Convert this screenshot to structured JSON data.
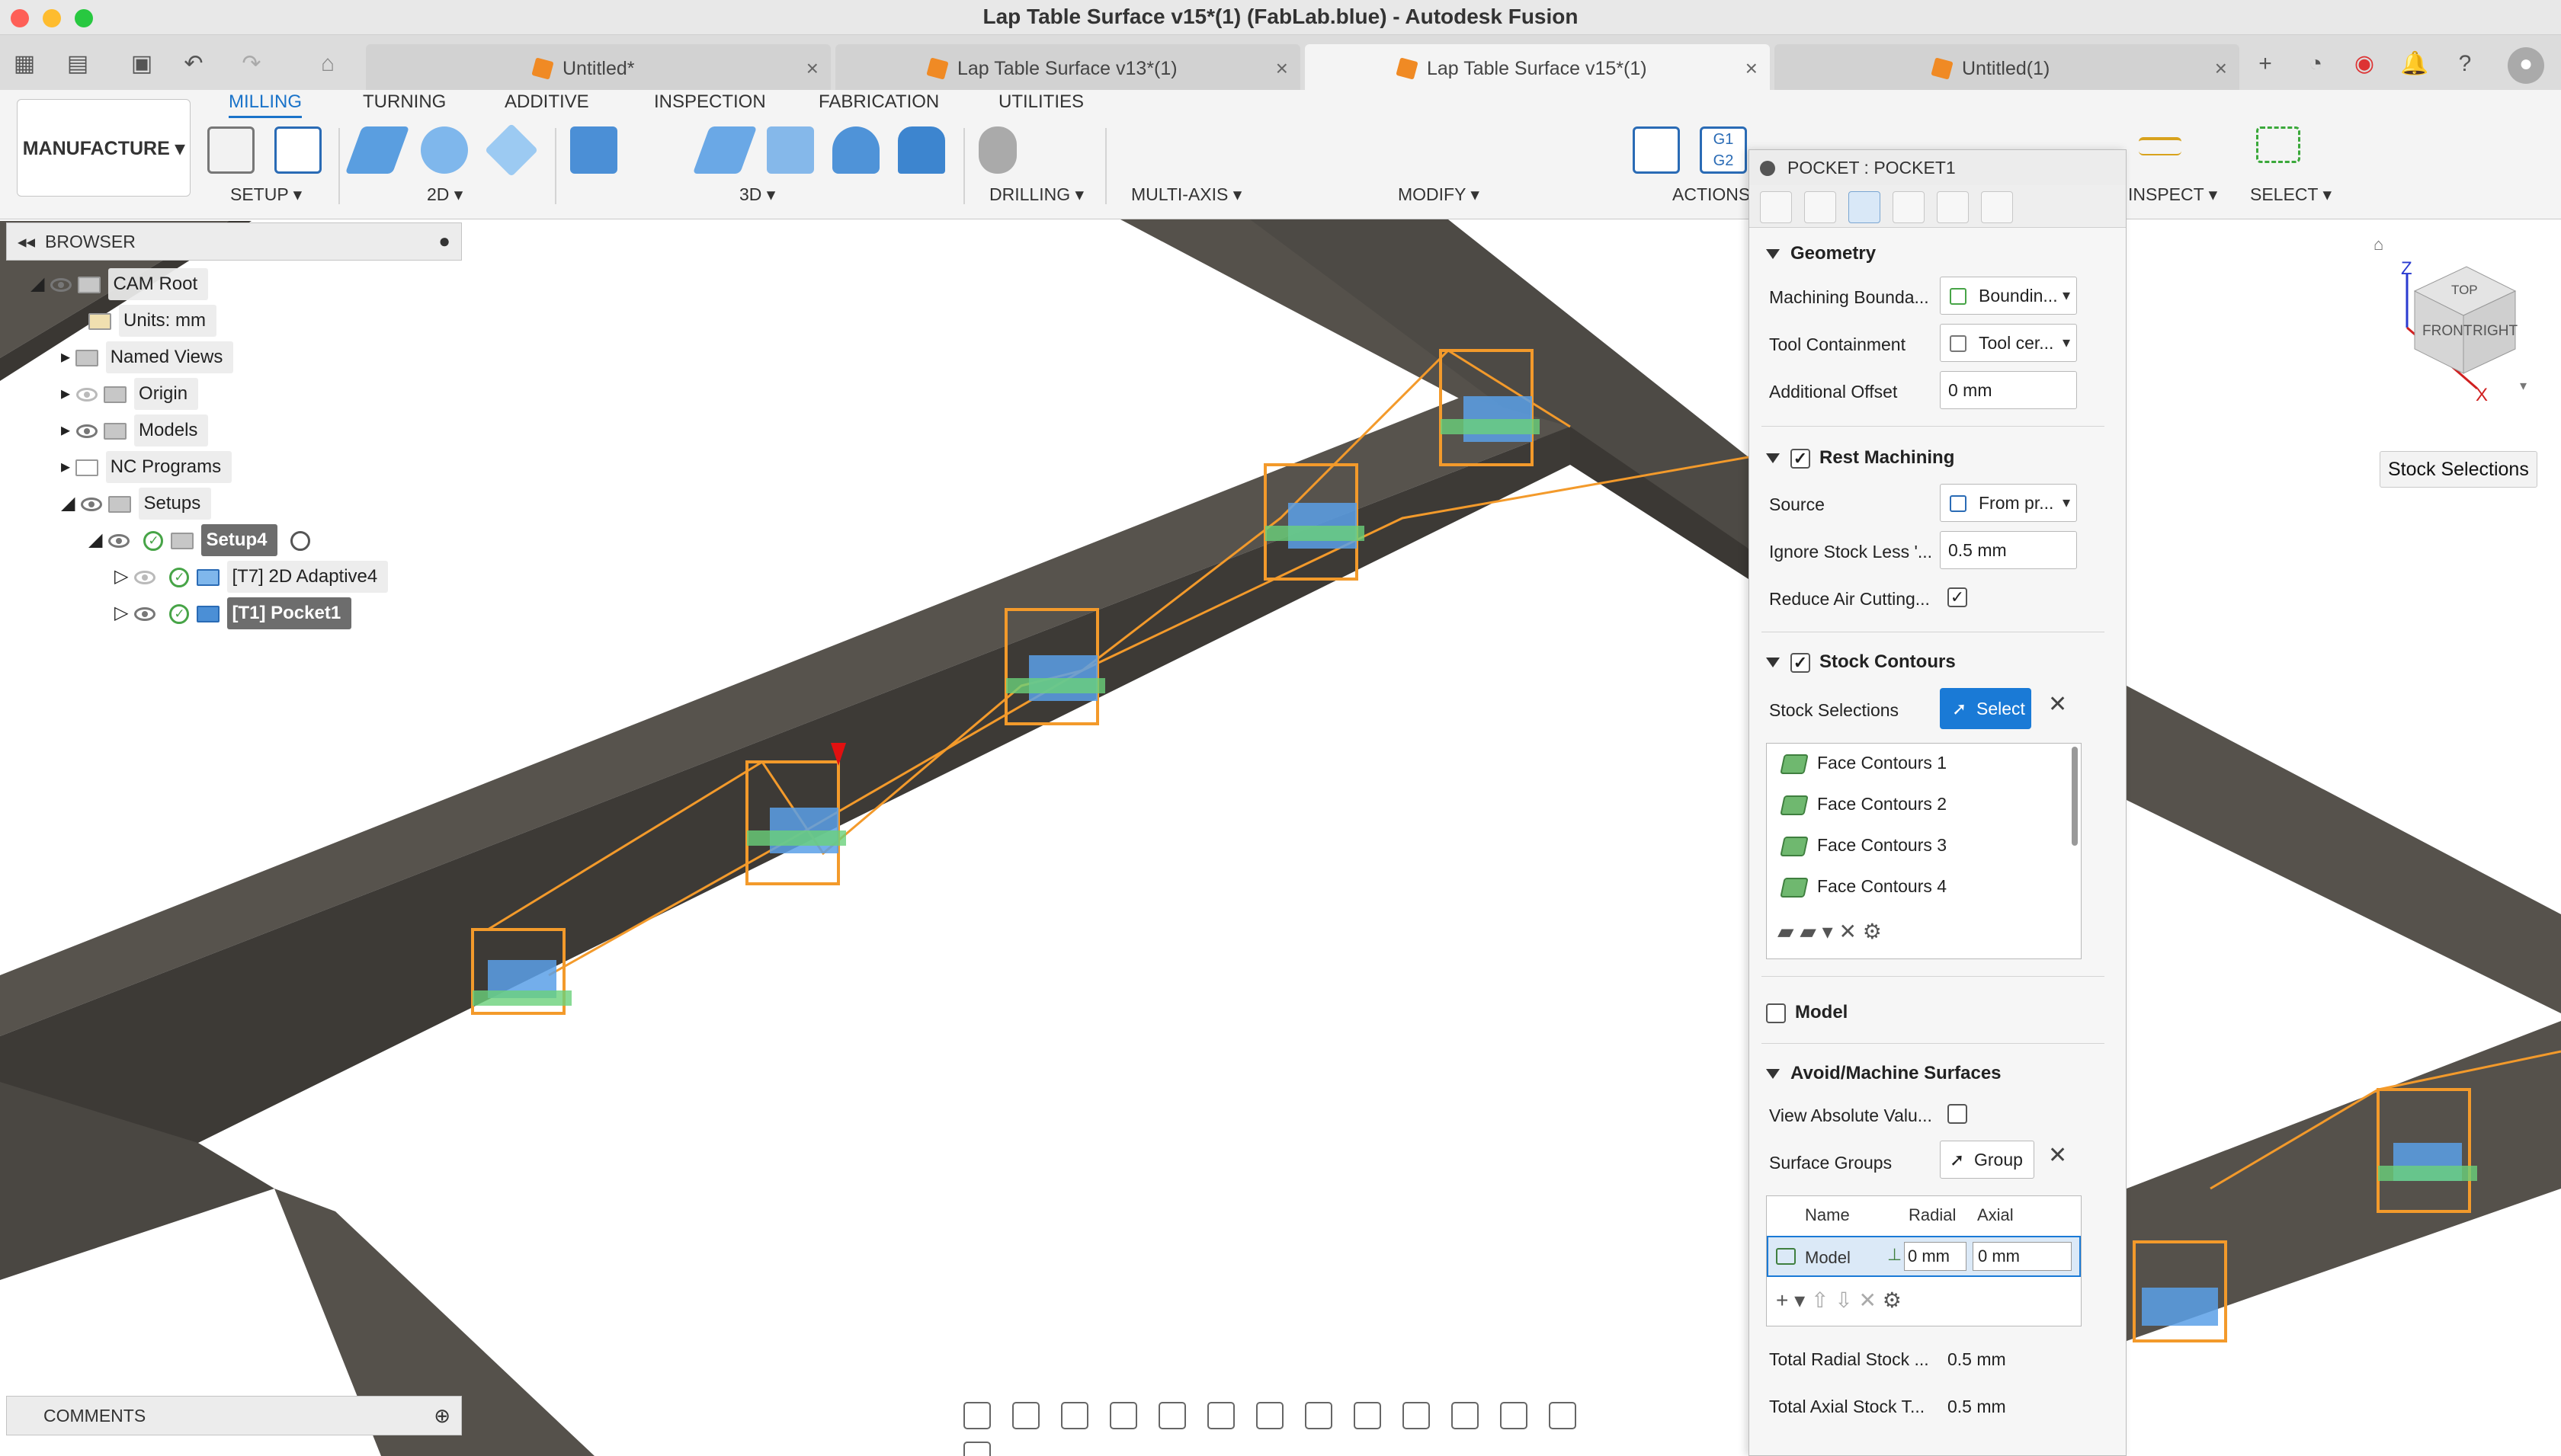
{
  "window": {
    "title": "Lap Table Surface v15*(1) (FabLab.blue) - Autodesk Fusion"
  },
  "doc_tabs": [
    {
      "label": "Untitled*"
    },
    {
      "label": "Lap Table Surface v13*(1)"
    },
    {
      "label": "Lap Table Surface v15*(1)"
    },
    {
      "label": "Untitled(1)"
    }
  ],
  "colors": {
    "accent": "#1a7ad6",
    "toolpath": "#f39a2b",
    "stock": "#4d4a45",
    "link": "#f39a2b"
  },
  "ribbon": {
    "workspace": "MANUFACTURE",
    "tabs": [
      "MILLING",
      "TURNING",
      "ADDITIVE",
      "INSPECTION",
      "FABRICATION",
      "UTILITIES"
    ],
    "groups": [
      "SETUP",
      "2D",
      "3D",
      "DRILLING",
      "MULTI-AXIS",
      "MODIFY",
      "ACTIONS",
      "INSPECT",
      "SELECT"
    ]
  },
  "browser": {
    "title": "BROWSER",
    "items": [
      "CAM Root",
      "Units: mm",
      "Named Views",
      "Origin",
      "Models",
      "NC Programs",
      "Setups",
      "Setup4",
      "[T7] 2D Adaptive4",
      "[T1] Pocket1"
    ]
  },
  "panel": {
    "title": "POCKET : POCKET1",
    "geometry": {
      "header": "Geometry",
      "machining_boundary_label": "Machining Bounda...",
      "machining_boundary_value": "Boundin...",
      "tool_containment_label": "Tool Containment",
      "tool_containment_value": "Tool cer...",
      "additional_offset_label": "Additional Offset",
      "additional_offset_value": "0 mm"
    },
    "rest": {
      "header": "Rest Machining",
      "source_label": "Source",
      "source_value": "From pr...",
      "ignore_label": "Ignore Stock Less '...",
      "ignore_value": "0.5 mm",
      "reduce_label": "Reduce Air Cutting..."
    },
    "stock": {
      "header": "Stock Contours",
      "selections_label": "Stock Selections",
      "select_btn": "Select",
      "items": [
        "Face Contours 1",
        "Face Contours 2",
        "Face Contours 3",
        "Face Contours 4"
      ]
    },
    "model": {
      "header": "Model"
    },
    "avoid": {
      "header": "Avoid/Machine Surfaces",
      "view_abs_label": "View Absolute Valu...",
      "surface_groups_label": "Surface Groups",
      "group_btn": "Group",
      "col_name": "Name",
      "col_radial": "Radial",
      "col_axial": "Axial",
      "row_name": "Model",
      "row_radial": "0 mm",
      "row_axial": "0 mm",
      "total_radial_label": "Total Radial Stock ...",
      "total_radial_value": "0.5 mm",
      "total_axial_label": "Total Axial Stock T...",
      "total_axial_value": "0.5 mm"
    }
  },
  "viewcube": {
    "top": "TOP",
    "front": "FRONT",
    "right": "RIGHT",
    "z": "Z",
    "x": "X"
  },
  "tooltip": "Stock Selections",
  "comments": "COMMENTS"
}
